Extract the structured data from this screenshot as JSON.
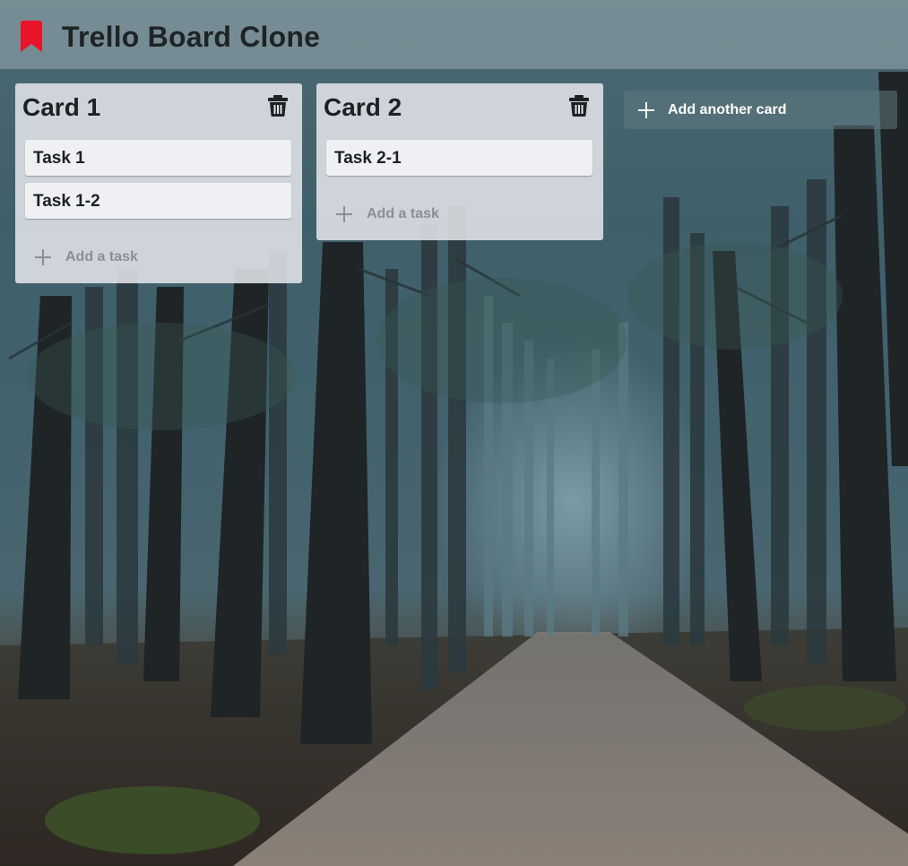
{
  "header": {
    "title": "Trello Board Clone",
    "icon": "bookmark-icon",
    "icon_color": "#e8142a"
  },
  "lists": [
    {
      "title": "Card 1",
      "tasks": [
        "Task 1",
        "Task 1-2"
      ],
      "add_task_label": "Add a task"
    },
    {
      "title": "Card 2",
      "tasks": [
        "Task 2-1"
      ],
      "add_task_label": "Add a task"
    }
  ],
  "add_card": {
    "label": "Add another card",
    "icon": "plus-icon"
  },
  "colors": {
    "list_background": "#e1e4e8",
    "task_background": "#eef0f3",
    "text_dark": "#1d2124",
    "muted_text": "#8a8f94"
  }
}
